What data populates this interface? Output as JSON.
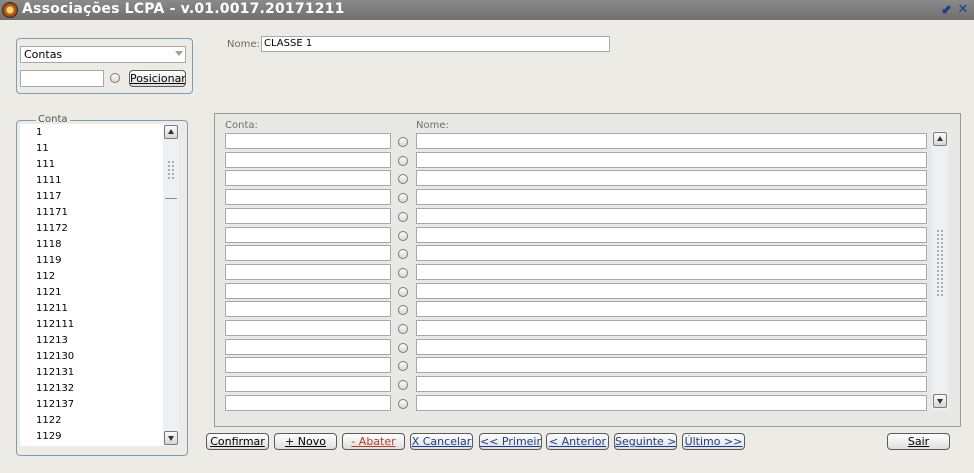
{
  "window": {
    "title": "Associações LCPA - v.01.0017.20171211",
    "minimize_glyph": "⬋",
    "close_glyph": "✕"
  },
  "top_panel": {
    "select_value": "Contas",
    "position_input_value": "",
    "position_button": "Posicionar"
  },
  "nome": {
    "label": "Nome:",
    "value": "CLASSE 1"
  },
  "conta_list": {
    "label": "Conta",
    "items": [
      "1",
      "11",
      "111",
      "1111",
      "1117",
      "11171",
      "11172",
      "1118",
      "1119",
      "112",
      "1121",
      "11211",
      "112111",
      "11213",
      "112130",
      "112131",
      "112132",
      "112137",
      "1122",
      "1129"
    ]
  },
  "grid": {
    "col_conta": "Conta:",
    "col_nome": "Nome:",
    "rows": [
      {
        "conta": "",
        "nome": ""
      },
      {
        "conta": "",
        "nome": ""
      },
      {
        "conta": "",
        "nome": ""
      },
      {
        "conta": "",
        "nome": ""
      },
      {
        "conta": "",
        "nome": ""
      },
      {
        "conta": "",
        "nome": ""
      },
      {
        "conta": "",
        "nome": ""
      },
      {
        "conta": "",
        "nome": ""
      },
      {
        "conta": "",
        "nome": ""
      },
      {
        "conta": "",
        "nome": ""
      },
      {
        "conta": "",
        "nome": ""
      },
      {
        "conta": "",
        "nome": ""
      },
      {
        "conta": "",
        "nome": ""
      },
      {
        "conta": "",
        "nome": ""
      },
      {
        "conta": "",
        "nome": ""
      }
    ]
  },
  "buttons": {
    "confirmar": "Confirmar",
    "novo": "+ Novo",
    "abater": "- Abater",
    "cancelar": "X Cancelar",
    "primeiro": "<< Primeiro",
    "anterior": "< Anterior",
    "seguinte": "Seguinte >",
    "ultimo": "Último >>",
    "sair": "Sair"
  }
}
